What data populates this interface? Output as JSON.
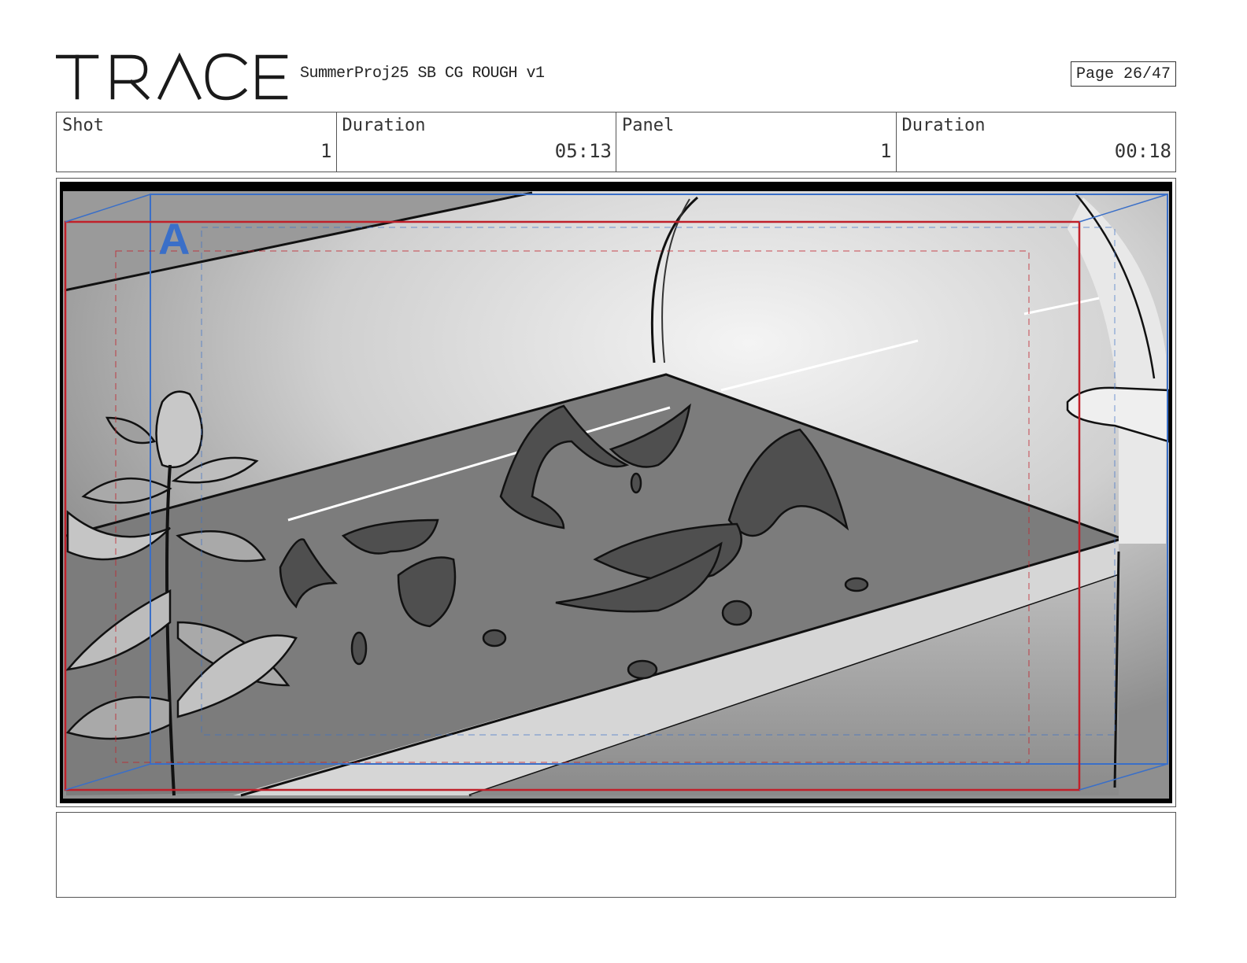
{
  "header": {
    "logo_text": "TRACE",
    "project_title": "SummerProj25 SB CG ROUGH v1",
    "page": "Page 26/47"
  },
  "info": {
    "shot_label": "Shot",
    "shot_value": "1",
    "shot_duration_label": "Duration",
    "shot_duration_value": "05:13",
    "panel_label": "Panel",
    "panel_value": "1",
    "panel_duration_label": "Duration",
    "panel_duration_value": "00:18"
  },
  "panel": {
    "camera_label": "A",
    "colors": {
      "safe_frame": "#c0202a",
      "camera_frame": "#3a6fc8",
      "label": "#3a6fc8"
    }
  },
  "notes": {
    "text": ""
  }
}
